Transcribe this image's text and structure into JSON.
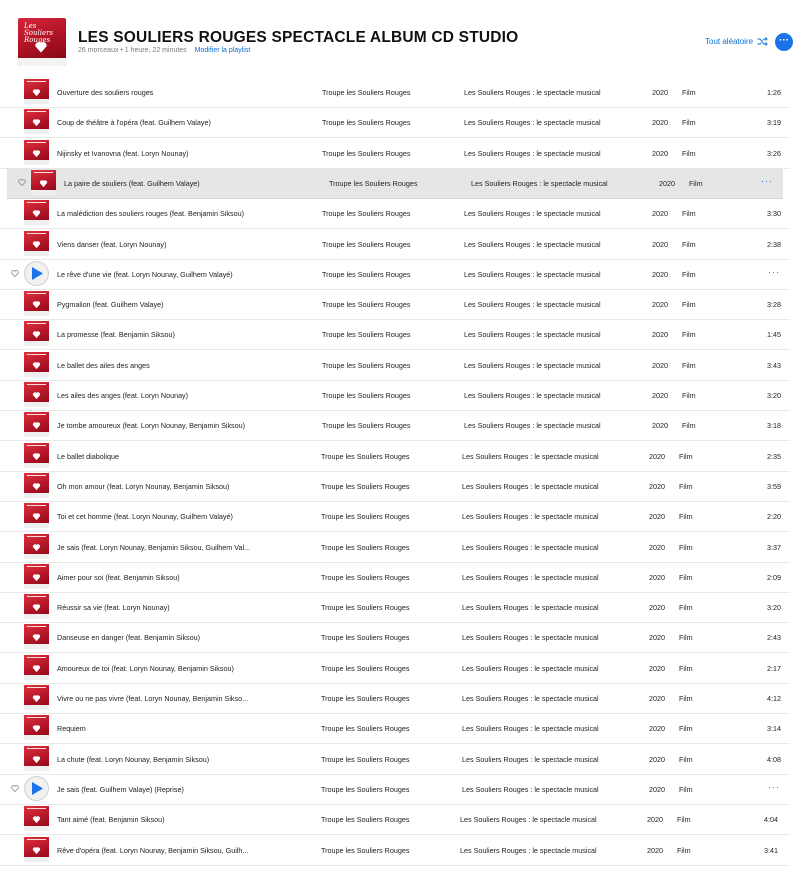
{
  "header": {
    "cover_label": "Les Souliers Rouges",
    "title": "LES SOULIERS ROUGES SPECTACLE ALBUM CD STUDIO",
    "meta": "26 morceaux • 1 heure, 22 minutes",
    "edit_link": "Modifier la playlist",
    "shuffle_label": "Tout aléatoire",
    "more_label": "···",
    "accent_color": "#1a73e8"
  },
  "tracks": [
    {
      "name": "Ouverture des souliers rouges",
      "artist": "Troupe les Souliers Rouges",
      "album": "Les Souliers Rouges : le spectacle musical",
      "year": "2020",
      "genre": "Film",
      "duration": "1:26"
    },
    {
      "name": "Coup de théâtre à l'opéra (feat. Guilhem Valaye)",
      "artist": "Troupe les Souliers Rouges",
      "album": "Les Souliers Rouges : le spectacle musical",
      "year": "2020",
      "genre": "Film",
      "duration": "3:19"
    },
    {
      "name": "Nijinsky et Ivanovna (feat. Loryn Nounay)",
      "artist": "Troupe les Souliers Rouges",
      "album": "Les Souliers Rouges : le spectacle musical",
      "year": "2020",
      "genre": "Film",
      "duration": "3:26"
    },
    {
      "name": "La paire de souliers (feat. Guilhem Valaye)",
      "artist": "Troupe les Souliers Rouges",
      "album": "Les Souliers Rouges : le spectacle musical",
      "year": "2020",
      "genre": "Film",
      "duration": "···"
    },
    {
      "name": "La malédiction des souliers rouges (feat. Benjamin Siksou)",
      "artist": "Troupe les Souliers Rouges",
      "album": "Les Souliers Rouges : le spectacle musical",
      "year": "2020",
      "genre": "Film",
      "duration": "3:30"
    },
    {
      "name": "Viens danser (feat. Loryn Nounay)",
      "artist": "Troupe les Souliers Rouges",
      "album": "Les Souliers Rouges : le spectacle musical",
      "year": "2020",
      "genre": "Film",
      "duration": "2:38"
    },
    {
      "name": "Le rêve d'une vie (feat. Loryn Nounay, Guilhem Valayé)",
      "artist": "Troupe les Souliers Rouges",
      "album": "Les Souliers Rouges : le spectacle musical",
      "year": "2020",
      "genre": "Film",
      "duration": "···"
    },
    {
      "name": "Pygmalion (feat. Guilhem Valaye)",
      "artist": "Troupe les Souliers Rouges",
      "album": "Les Souliers Rouges : le spectacle musical",
      "year": "2020",
      "genre": "Film",
      "duration": "3:28"
    },
    {
      "name": "La promesse (feat. Benjamin Siksou)",
      "artist": "Troupe les Souliers Rouges",
      "album": "Les Souliers Rouges : le spectacle musical",
      "year": "2020",
      "genre": "Film",
      "duration": "1:45"
    },
    {
      "name": "Le ballet des ailes des anges",
      "artist": "Troupe les Souliers Rouges",
      "album": "Les Souliers Rouges : le spectacle musical",
      "year": "2020",
      "genre": "Film",
      "duration": "3:43"
    },
    {
      "name": "Les ailes des anges (feat. Loryn Nounay)",
      "artist": "Troupe les Souliers Rouges",
      "album": "Les Souliers Rouges : le spectacle musical",
      "year": "2020",
      "genre": "Film",
      "duration": "3:20"
    },
    {
      "name": "Je tombe amoureux (feat. Loryn Nounay, Benjamin Siksou)",
      "artist": "Troupe les Souliers Rouges",
      "album": "Les Souliers Rouges : le spectacle musical",
      "year": "2020",
      "genre": "Film",
      "duration": "3:18"
    },
    {
      "name": "Le ballet diabolique",
      "artist": "Troupe les Souliers Rouges",
      "album": "Les Souliers Rouges : le spectacle musical",
      "year": "2020",
      "genre": "Film",
      "duration": "2:35"
    },
    {
      "name": "Oh mon amour (feat. Loryn Nounay, Benjamin Siksou)",
      "artist": "Troupe les Souliers Rouges",
      "album": "Les Souliers Rouges : le spectacle musical",
      "year": "2020",
      "genre": "Film",
      "duration": "3:59"
    },
    {
      "name": "Toi et cet homme (feat. Loryn Nounay, Guilhem Valayé)",
      "artist": "Troupe les Souliers Rouges",
      "album": "Les Souliers Rouges : le spectacle musical",
      "year": "2020",
      "genre": "Film",
      "duration": "2:20"
    },
    {
      "name": "Je sais (feat. Loryn Nounay, Benjamin Siksou, Guilhem Val...",
      "artist": "Troupe les Souliers Rouges",
      "album": "Les Souliers Rouges : le spectacle musical",
      "year": "2020",
      "genre": "Film",
      "duration": "3:37"
    },
    {
      "name": "Aimer pour soi (feat. Benjamin Siksou)",
      "artist": "Troupe les Souliers Rouges",
      "album": "Les Souliers Rouges : le spectacle musical",
      "year": "2020",
      "genre": "Film",
      "duration": "2:09"
    },
    {
      "name": "Réussir sa vie (feat. Loryn Nounay)",
      "artist": "Troupe les Souliers Rouges",
      "album": "Les Souliers Rouges : le spectacle musical",
      "year": "2020",
      "genre": "Film",
      "duration": "3:20"
    },
    {
      "name": "Danseuse en danger (feat. Benjamin Siksou)",
      "artist": "Troupe les Souliers Rouges",
      "album": "Les Souliers Rouges : le spectacle musical",
      "year": "2020",
      "genre": "Film",
      "duration": "2:43"
    },
    {
      "name": "Amoureux de toi (feat. Loryn Nounay, Benjamin Siksou)",
      "artist": "Troupe les Souliers Rouges",
      "album": "Les Souliers Rouges : le spectacle musical",
      "year": "2020",
      "genre": "Film",
      "duration": "2:17"
    },
    {
      "name": "Vivre ou ne pas vivre (feat. Loryn Nounay, Benjamin Siksо...",
      "artist": "Troupe les Souliers Rouges",
      "album": "Les Souliers Rouges : le spectacle musical",
      "year": "2020",
      "genre": "Film",
      "duration": "4:12"
    },
    {
      "name": "Requiem",
      "artist": "Troupe les Souliers Rouges",
      "album": "Les Souliers Rouges : le spectacle musical",
      "year": "2020",
      "genre": "Film",
      "duration": "3:14"
    },
    {
      "name": "La chute (feat. Loryn Nounay, Benjamin Siksou)",
      "artist": "Troupe les Souliers Rouges",
      "album": "Les Souliers Rouges : le spectacle musical",
      "year": "2020",
      "genre": "Film",
      "duration": "4:08"
    },
    {
      "name": "Je sais (feat. Guilhem Valaye)  (Reprise)",
      "artist": "Troupe les Souliers Rouges",
      "album": "Les Souliers Rouges : le spectacle musical",
      "year": "2020",
      "genre": "Film",
      "duration": "···"
    },
    {
      "name": "Tant aimé (feat. Benjamin Siksou)",
      "artist": "Troupe les Souliers Rouges",
      "album": "Les Souliers Rouges : le spectacle musical",
      "year": "2020",
      "genre": "Film",
      "duration": "4:04"
    },
    {
      "name": "Rêve d'opéra (feat. Loryn Nounay, Benjamin Siksou, Guilh...",
      "artist": "Troupe les Souliers Rouges",
      "album": "Les Souliers Rouges : le spectacle musical",
      "year": "2020",
      "genre": "Film",
      "duration": "3:41"
    }
  ]
}
